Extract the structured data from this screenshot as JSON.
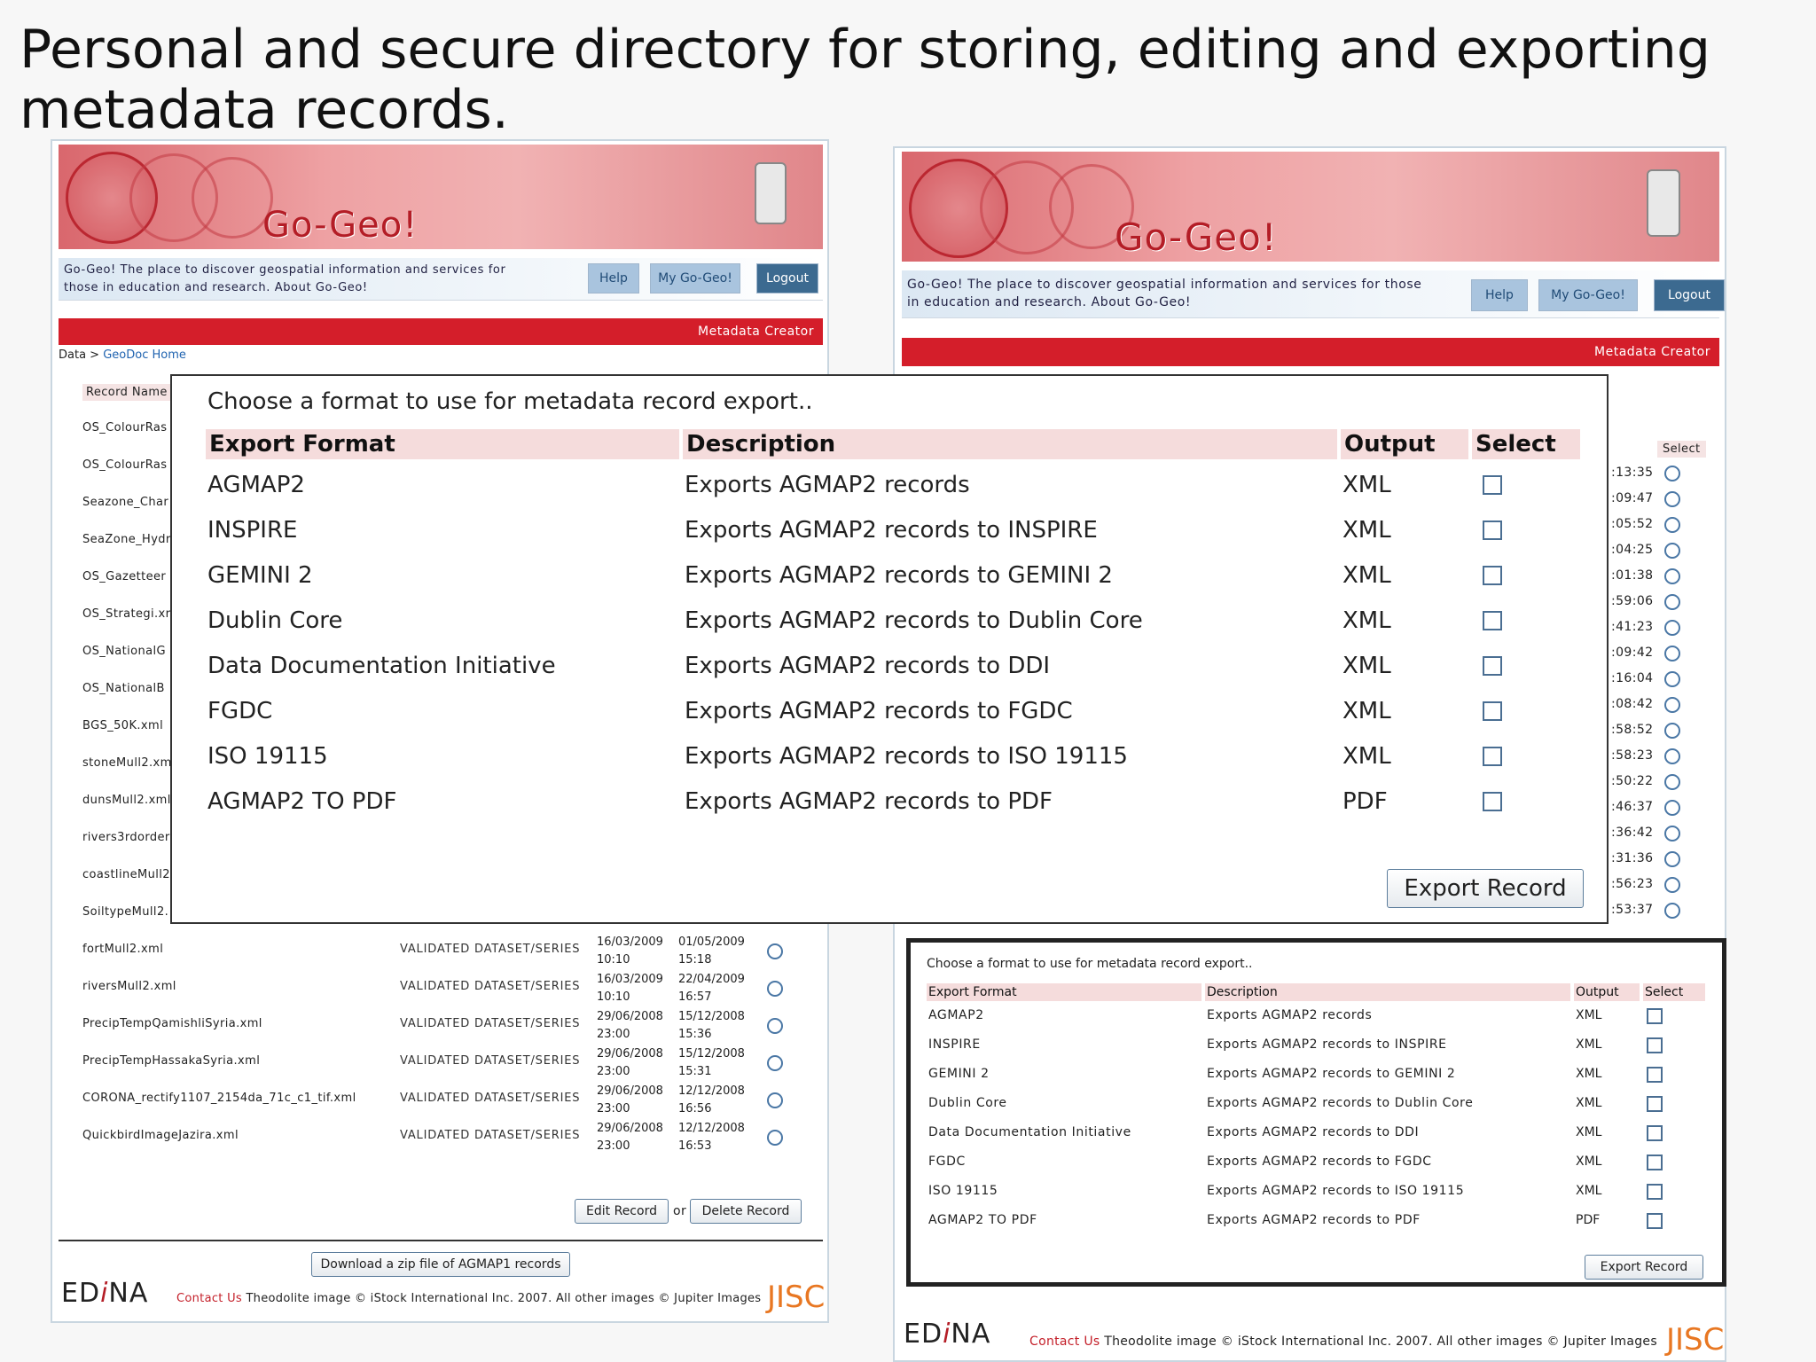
{
  "slide": {
    "title": "Personal and secure directory for storing, editing and exporting metadata records."
  },
  "app": {
    "brand": "Go-Geo!",
    "info_text": "Go-Geo! The place to discover geospatial information and services for those in education and research. About Go-Geo!",
    "nav": {
      "help": "Help",
      "my": "My Go-Geo!",
      "logout": "Logout"
    },
    "section": "Metadata Creator",
    "breadcrumb": {
      "prefix": "Data >",
      "link": "GeoDoc Home"
    },
    "colors": {
      "accent_red": "#d41e2a",
      "nav_blue": "#a9c4de",
      "nav_dark": "#3c6a90",
      "jisc_orange": "#e87722"
    }
  },
  "records_table": {
    "col_record_name": "Record Name",
    "col_select": "Select",
    "names_partial": [
      "OS_ColourRas",
      "OS_ColourRas",
      "Seazone_Char",
      "SeaZone_Hydr",
      "OS_Gazetteer",
      "OS_Strategi.xr",
      "OS_NationalG",
      "OS_NationalB",
      "BGS_50K.xml",
      "stoneMull2.xm",
      "dunsMull2.xml",
      "rivers3rdorderM",
      "coastlineMull2",
      "SoiltypeMull2."
    ],
    "times_partial": [
      ":13:35",
      ":09:47",
      ":05:52",
      ":04:25",
      ":01:38",
      ":59:06",
      ":41:23",
      ":09:42",
      ":16:04",
      ":08:42",
      ":58:52",
      ":58:23",
      ":50:22",
      ":46:37",
      ":36:42",
      ":31:36",
      ":56:23",
      ":53:37"
    ],
    "rows": [
      {
        "name": "fortMull2.xml",
        "status": "VALIDATED DATASET/SERIES",
        "created_date": "16/03/2009",
        "created_time": "10:10",
        "modified_date": "01/05/2009",
        "modified_time": "15:18"
      },
      {
        "name": "riversMull2.xml",
        "status": "VALIDATED DATASET/SERIES",
        "created_date": "16/03/2009",
        "created_time": "10:10",
        "modified_date": "22/04/2009",
        "modified_time": "16:57"
      },
      {
        "name": "PrecipTempQamishliSyria.xml",
        "status": "VALIDATED DATASET/SERIES",
        "created_date": "29/06/2008",
        "created_time": "23:00",
        "modified_date": "15/12/2008",
        "modified_time": "15:36"
      },
      {
        "name": "PrecipTempHassakaSyria.xml",
        "status": "VALIDATED DATASET/SERIES",
        "created_date": "29/06/2008",
        "created_time": "23:00",
        "modified_date": "15/12/2008",
        "modified_time": "15:31"
      },
      {
        "name": "CORONA_rectify1107_2154da_71c_c1_tif.xml",
        "status": "VALIDATED DATASET/SERIES",
        "created_date": "29/06/2008",
        "created_time": "23:00",
        "modified_date": "12/12/2008",
        "modified_time": "16:56"
      },
      {
        "name": "QuickbirdImageJazira.xml",
        "status": "VALIDATED DATASET/SERIES",
        "created_date": "29/06/2008",
        "created_time": "23:00",
        "modified_date": "12/12/2008",
        "modified_time": "16:53"
      }
    ],
    "edit_button": "Edit Record",
    "or_text": "or",
    "delete_button": "Delete Record",
    "download_button": "Download a zip file of AGMAP1 records"
  },
  "export_dialog": {
    "heading": "Choose a format to use for metadata record export..",
    "headers": {
      "format": "Export Format",
      "description": "Description",
      "output": "Output",
      "select": "Select"
    },
    "formats": [
      {
        "format": "AGMAP2",
        "description": "Exports AGMAP2 records",
        "output": "XML"
      },
      {
        "format": "INSPIRE",
        "description": "Exports AGMAP2 records to INSPIRE",
        "output": "XML"
      },
      {
        "format": "GEMINI 2",
        "description": "Exports AGMAP2 records to GEMINI 2",
        "output": "XML"
      },
      {
        "format": "Dublin Core",
        "description": "Exports AGMAP2 records to Dublin Core",
        "output": "XML"
      },
      {
        "format": "Data Documentation Initiative",
        "description": "Exports AGMAP2 records to DDI",
        "output": "XML"
      },
      {
        "format": "FGDC",
        "description": "Exports AGMAP2 records to FGDC",
        "output": "XML"
      },
      {
        "format": "ISO 19115",
        "description": "Exports AGMAP2 records to ISO 19115",
        "output": "XML"
      },
      {
        "format": "AGMAP2 TO PDF",
        "description": "Exports AGMAP2 records to PDF",
        "output": "PDF"
      }
    ],
    "export_button": "Export Record"
  },
  "footer": {
    "edina_left": "ED",
    "edina_mid": "i",
    "edina_right": "NA",
    "contact": "Contact Us",
    "credit": "Theodolite image © iStock International Inc. 2007. All other images © Jupiter Images",
    "jisc": "JISC"
  }
}
